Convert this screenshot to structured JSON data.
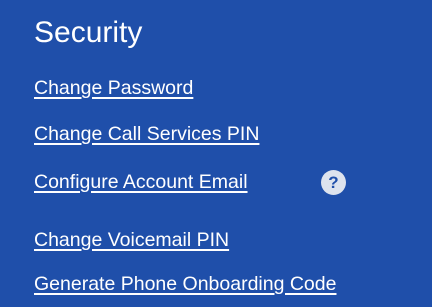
{
  "section": {
    "title": "Security",
    "links": [
      "Change Password",
      "Change Call Services PIN",
      "Configure Account Email",
      "Change Voicemail PIN",
      "Generate Phone Onboarding Code"
    ],
    "help_icon_glyph": "?"
  },
  "colors": {
    "panel_background": "#1f4faa",
    "text": "#ffffff",
    "help_icon_background": "#dde3ee"
  },
  "icons": {
    "help": "question-circle-icon"
  }
}
